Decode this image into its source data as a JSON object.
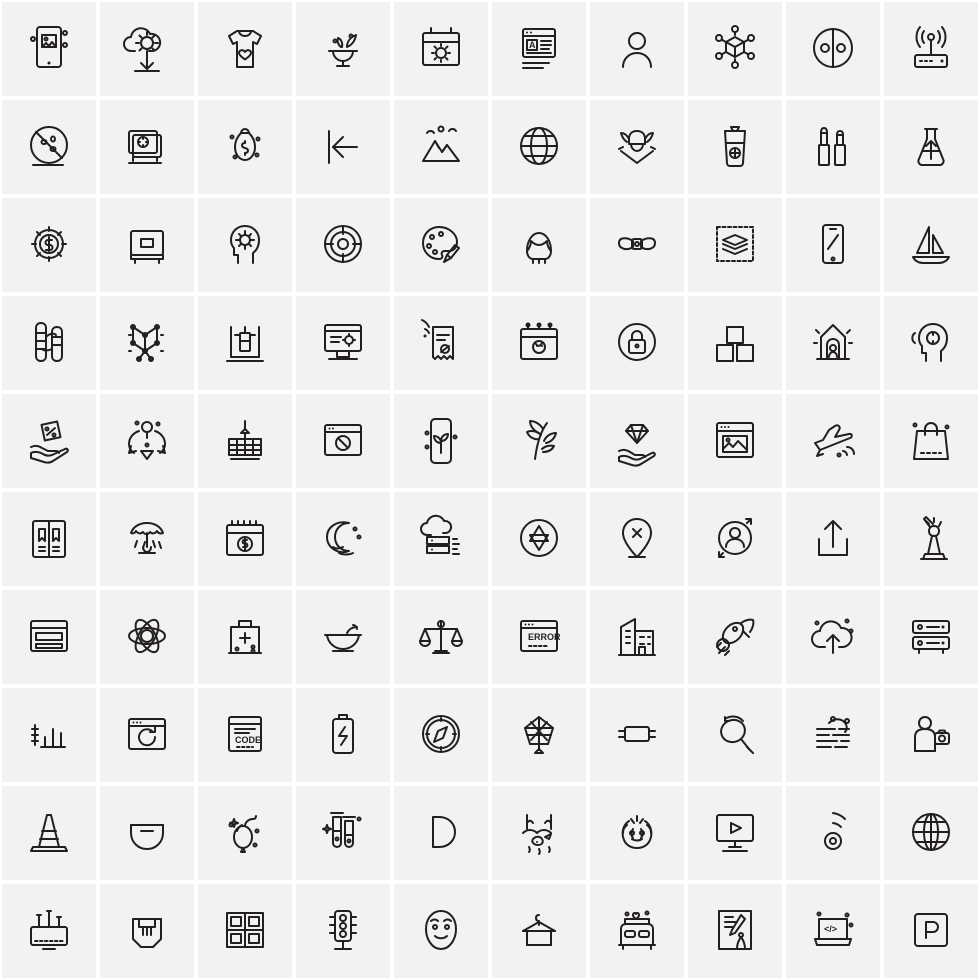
{
  "sheet": {
    "title": "Line Icon Sheet",
    "columns": 10,
    "rows": 10,
    "cell_size_px": 98,
    "background_color": "#ffffff",
    "tile_color": "#f2f2f2",
    "stroke_color": "#231f20",
    "icon_labels": [
      "mobile-photo-gallery-icon",
      "cloud-settings-upload-icon",
      "tshirt-heart-print-icon",
      "mortar-pestle-herbs-icon",
      "calendar-sun-icon",
      "online-article-document-icon",
      "user-avatar-icon",
      "cube-network-icon",
      "yin-yang-circle-icon",
      "wifi-router-icon",
      "no-pills-prohibited-icon",
      "safe-vault-camera-icon",
      "money-bag-dollar-icon",
      "arrow-to-left-line-icon",
      "mountain-landscape-icon",
      "globe-grid-icon",
      "viking-helmet-swords-icon",
      "cocktail-drink-glass-icon",
      "lipstick-cosmetics-icon",
      "laboratory-flask-arrow-icon",
      "dollar-gear-settings-icon",
      "safe-deposit-box-icon",
      "head-brain-atom-icon",
      "target-crosshair-icon",
      "paint-palette-brush-icon",
      "wig-hair-icon",
      "bow-tie-icon",
      "layers-stack-icon",
      "smartphone-screen-icon",
      "sailboat-icon",
      "bamboo-plant-icon",
      "molecular-lattice-icon",
      "chemistry-stand-burner-icon",
      "desktop-settings-icon",
      "wifi-receipt-bill-icon",
      "calendar-artist-palette-icon",
      "padlock-circle-icon",
      "cubes-blocks-icon",
      "fairy-tale-house-icon",
      "head-idea-bulb-icon",
      "hand-discount-tag-icon",
      "recycling-arrows-icon",
      "crane-hook-container-icon",
      "browser-no-image-icon",
      "mobile-plant-growth-icon",
      "branch-leaves-icon",
      "hand-diamond-icon",
      "browser-image-window-icon",
      "airplane-departure-icon",
      "shopping-bag-icon",
      "open-book-bookmarks-icon",
      "rain-cloud-umbrella-icon",
      "calendar-dollar-payday-icon",
      "crescent-moon-clouds-icon",
      "cloud-server-database-icon",
      "star-of-david-circle-icon",
      "location-pin-cancel-icon",
      "user-orbit-circle-icon",
      "upload-tray-icon",
      "statue-of-liberty-icon",
      "browser-window-layout-icon",
      "atom-molecule-icon",
      "medical-first-aid-box-icon",
      "soup-bowl-spoon-icon",
      "balance-scales-justice-icon",
      "browser-error-page-icon",
      "office-building-icon",
      "rocket-launch-icon",
      "cloud-upload-icon",
      "server-rack-icon",
      "audio-equalizer-icon",
      "browser-refresh-loading-icon",
      "code-browser-window-icon",
      "battery-charging-icon",
      "compass-navigation-icon",
      "net-mesh-pattern-icon",
      "capacitor-component-icon",
      "magnifier-search-analysis-icon",
      "brick-wall-smoke-icon",
      "person-photo-camera-icon",
      "traffic-cone-icon",
      "minus-circle-bowl-icon",
      "balloon-celebration-icon",
      "chemistry-test-tubes-icon",
      "half-circle-shape-icon",
      "fishing-hook-fish-icon",
      "laurel-wreath-award-icon",
      "video-play-monitor-icon",
      "wireless-signal-icon",
      "globe-wireframe-icon",
      "computer-monitor-stand-icon",
      "ethernet-port-icon",
      "window-four-panes-icon",
      "traffic-light-signal-icon",
      "smiling-face-mask-icon",
      "clothes-hanger-towel-icon",
      "romantic-dinner-bed-icon",
      "scroll-compass-drafting-icon",
      "laptop-code-icon",
      "parking-sign-icon"
    ],
    "text_in_icons": {
      "error_page": "ERROR",
      "code_window": "CODE",
      "document_letter": "A",
      "parking_sign": "P",
      "laptop_code": "</>"
    }
  }
}
